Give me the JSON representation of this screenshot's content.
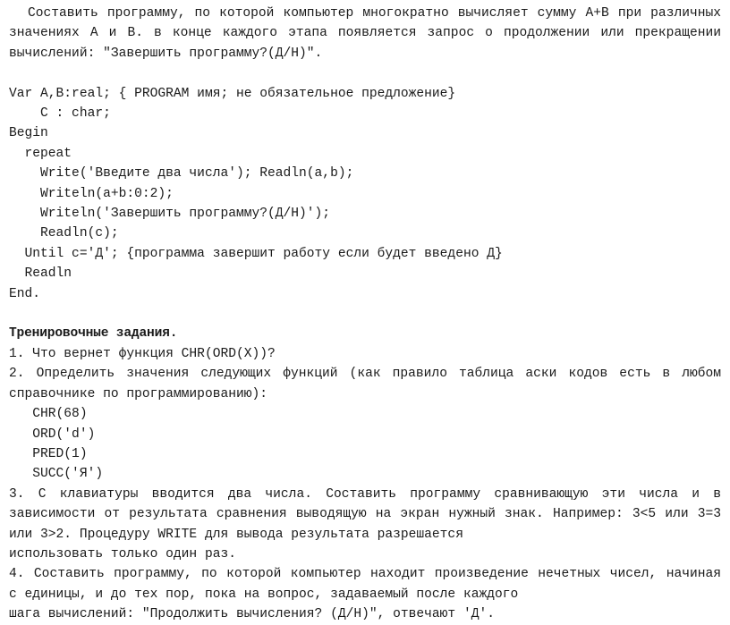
{
  "document": {
    "intro_paragraph": "Составить программу, по которой компьютер многократно вычисляет сумму A+B при различных значениях A и B. в конце каждого этапа появляется запрос о продолжении или прекращении вычислений: \"Завершить программу?(Д/Н)\".",
    "code_listing": "Var A,B:real; { PROGRAM имя; не обязательное предложение}\n    C : char;\nBegin\n  repeat\n    Write('Введите два числа'); Readln(a,b);\n    Writeln(a+b:0:2);\n    Writeln('Завершить программу?(Д/Н)');\n    Readln(c);\n  Until c='Д'; {программа завершит работу если будет введено Д}\n  Readln\nEnd.",
    "exercises_heading": "Тренировочные задания.",
    "task_1": "1. Что вернет функция CHR(ORD(X))?",
    "task_2": "2. Определить значения следующих функций (как правило таблица аски кодов есть в любом справочнике по программированию):",
    "function_list": "   CHR(68)\n   ORD('d')\n   PRED(1)\n   SUCC('Я')",
    "task_3": "3. С клавиатуры вводится два числа. Составить программу сравнивающую эти числа и в зависимости от результата сравнения выводящую на экран нужный знак. Например: 3<5 или 3=3 или 3>2. Процедуру WRITE для вывода результата разрешается",
    "task_3_last_line": "использовать только один раз.",
    "task_4": "4. Составить программу, по которой компьютер находит произведение нечетных чисел, начиная с единицы, и до тех пор, пока на вопрос, задаваемый после каждого",
    "task_4_last_line": "шага вычислений: \"Продолжить вычисления? (Д/Н)\", отвечают 'Д'."
  }
}
